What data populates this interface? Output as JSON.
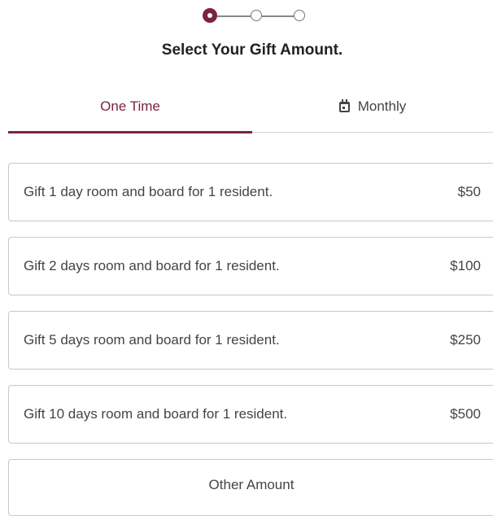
{
  "stepper": {
    "steps": 3,
    "current": 1
  },
  "header": {
    "title": "Select Your Gift Amount."
  },
  "tabs": [
    {
      "label": "One Time",
      "active": true
    },
    {
      "label": "Monthly",
      "active": false,
      "icon": "calendar-icon"
    }
  ],
  "options": [
    {
      "label": "Gift 1 day room and board for 1 resident.",
      "amount": "$50"
    },
    {
      "label": "Gift 2 days room and board for 1 resident.",
      "amount": "$100"
    },
    {
      "label": "Gift 5 days room and board for 1 resident.",
      "amount": "$250"
    },
    {
      "label": "Gift 10 days room and board for 1 resident.",
      "amount": "$500"
    }
  ],
  "other_amount": {
    "label": "Other Amount"
  },
  "colors": {
    "accent": "#7a2444",
    "border": "#c8c8c8",
    "text": "#444444"
  }
}
